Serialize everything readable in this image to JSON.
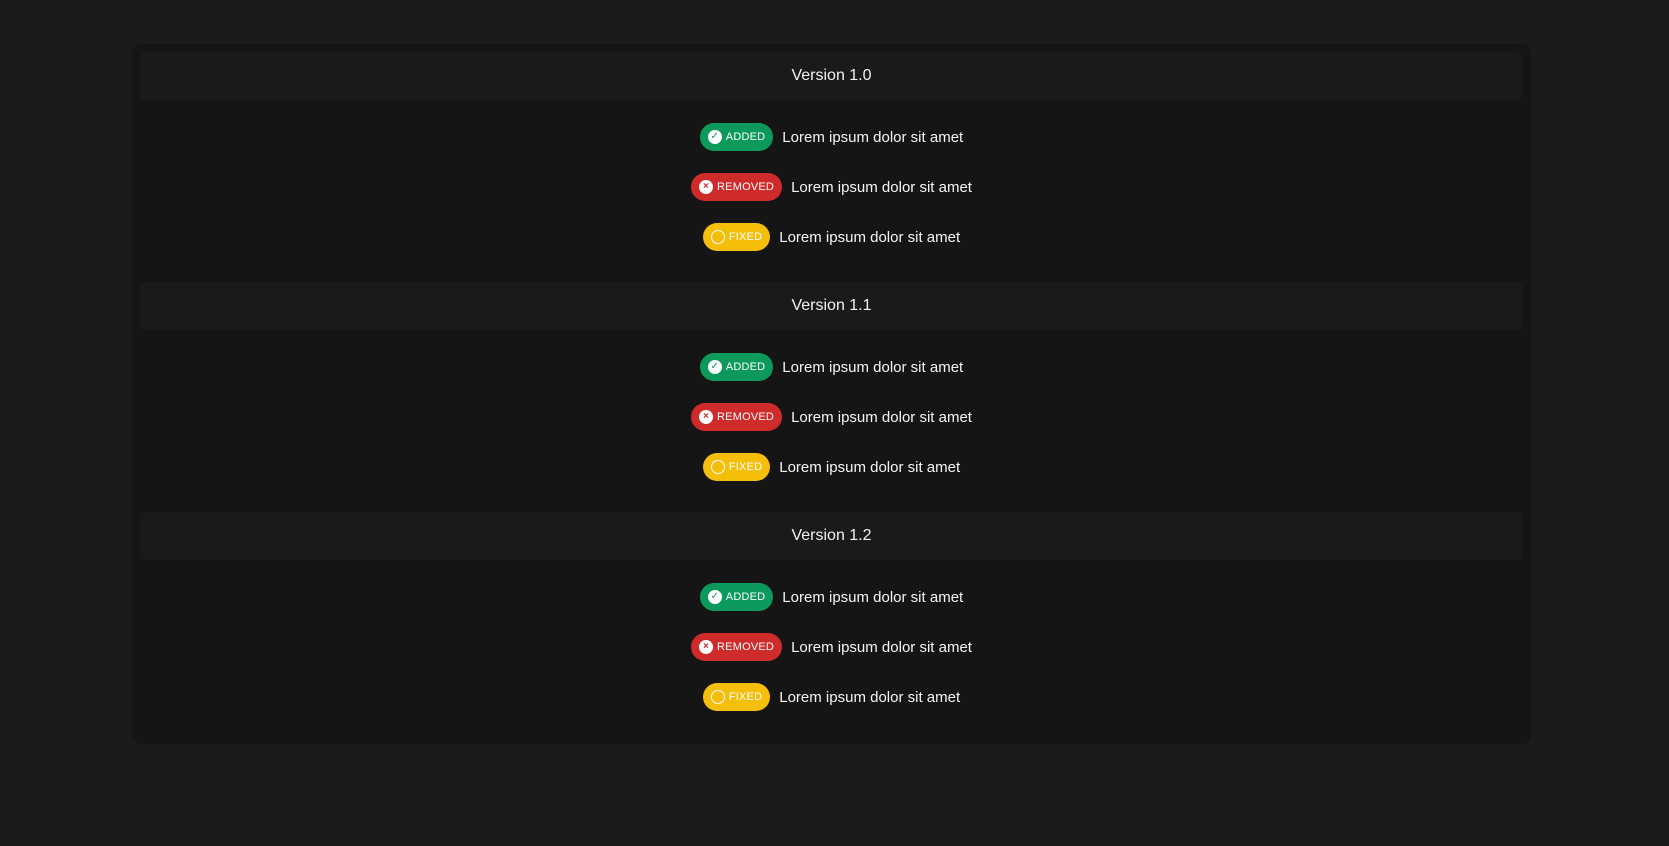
{
  "versions": [
    {
      "title": "Version 1.0",
      "entries": [
        {
          "type": "added",
          "badge": "ADDED",
          "icon": "check-circle-icon",
          "text": "Lorem ipsum dolor sit amet"
        },
        {
          "type": "removed",
          "badge": "REMOVED",
          "icon": "x-circle-icon",
          "text": "Lorem ipsum dolor sit amet"
        },
        {
          "type": "fixed",
          "badge": "FIXED",
          "icon": "info-circle-icon",
          "text": "Lorem ipsum dolor sit amet"
        }
      ]
    },
    {
      "title": "Version 1.1",
      "entries": [
        {
          "type": "added",
          "badge": "ADDED",
          "icon": "check-circle-icon",
          "text": "Lorem ipsum dolor sit amet"
        },
        {
          "type": "removed",
          "badge": "REMOVED",
          "icon": "x-circle-icon",
          "text": "Lorem ipsum dolor sit amet"
        },
        {
          "type": "fixed",
          "badge": "FIXED",
          "icon": "info-circle-icon",
          "text": "Lorem ipsum dolor sit amet"
        }
      ]
    },
    {
      "title": "Version 1.2",
      "entries": [
        {
          "type": "added",
          "badge": "ADDED",
          "icon": "check-circle-icon",
          "text": "Lorem ipsum dolor sit amet"
        },
        {
          "type": "removed",
          "badge": "REMOVED",
          "icon": "x-circle-icon",
          "text": "Lorem ipsum dolor sit amet"
        },
        {
          "type": "fixed",
          "badge": "FIXED",
          "icon": "info-circle-icon",
          "text": "Lorem ipsum dolor sit amet"
        }
      ]
    }
  ],
  "colors": {
    "added": "#0c9a5c",
    "removed": "#d02b2b",
    "fixed": "#f5be0b",
    "background": "#1b1b1b",
    "panel": "#151515"
  }
}
